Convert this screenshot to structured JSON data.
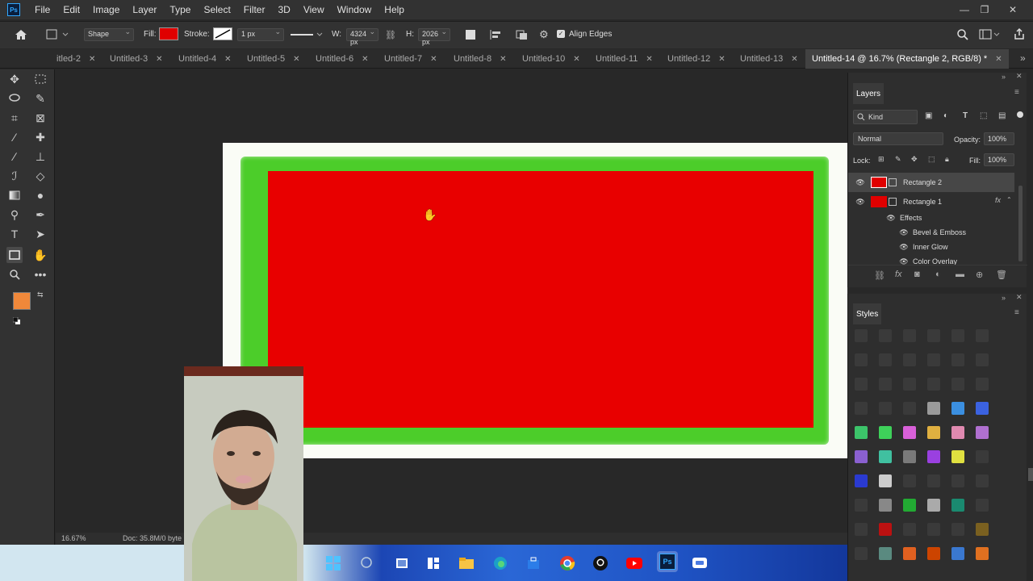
{
  "app": {
    "logo": "Ps"
  },
  "menu": [
    "File",
    "Edit",
    "Image",
    "Layer",
    "Type",
    "Select",
    "Filter",
    "3D",
    "View",
    "Window",
    "Help"
  ],
  "options": {
    "tool_mode": "Shape",
    "fill_label": "Fill:",
    "stroke_label": "Stroke:",
    "stroke_width": "1 px",
    "w_label": "W:",
    "w_value": "4324 px",
    "h_label": "H:",
    "h_value": "2026 px",
    "align_edges": "Align Edges",
    "fill_color": "#e00000"
  },
  "tabs": [
    {
      "label": "itled-2"
    },
    {
      "label": "Untitled-3"
    },
    {
      "label": "Untitled-4"
    },
    {
      "label": "Untitled-5"
    },
    {
      "label": "Untitled-6"
    },
    {
      "label": "Untitled-7"
    },
    {
      "label": "Untitled-8"
    },
    {
      "label": "Untitled-10"
    },
    {
      "label": "Untitled-11"
    },
    {
      "label": "Untitled-12"
    },
    {
      "label": "Untitled-13"
    },
    {
      "label": "Untitled-14 @ 16.7% (Rectangle 2, RGB/8) *"
    }
  ],
  "layers_panel": {
    "title": "Layers",
    "filter": "Kind",
    "blend_mode": "Normal",
    "opacity_label": "Opacity:",
    "opacity_value": "100%",
    "lock_label": "Lock:",
    "fill_label": "Fill:",
    "fill_value": "100%",
    "layers": [
      {
        "name": "Rectangle 2"
      },
      {
        "name": "Rectangle 1",
        "fx": "fx"
      }
    ],
    "effects_label": "Effects",
    "effects": [
      "Bevel & Emboss",
      "Inner Glow",
      "Color Overlay"
    ]
  },
  "styles_panel": {
    "title": "Styles"
  },
  "status": {
    "zoom": "16.67%",
    "doc": "Doc: 35.8M/0 byte"
  },
  "colors": {
    "foreground": "#f0883a",
    "background": "#eeeeee",
    "shape_fill": "#e80000",
    "shape_border": "#4ccd2a"
  },
  "taskbar": {
    "photoshop_badge": "Ps"
  }
}
